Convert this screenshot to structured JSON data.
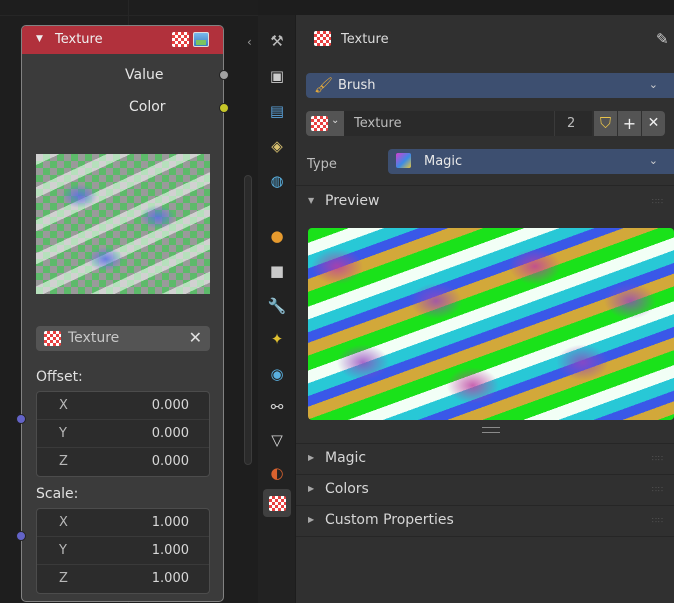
{
  "node": {
    "title": "Texture",
    "outputs": [
      {
        "label": "Value",
        "socket_color": "#a1a1a1"
      },
      {
        "label": "Color",
        "socket_color": "#c7c729"
      }
    ],
    "texture_field": {
      "label": "Texture",
      "clear": "✕"
    },
    "offset": {
      "label": "Offset:",
      "rows": [
        {
          "axis": "X",
          "value": "0.000"
        },
        {
          "axis": "Y",
          "value": "0.000"
        },
        {
          "axis": "Z",
          "value": "0.000"
        }
      ]
    },
    "scale": {
      "label": "Scale:",
      "rows": [
        {
          "axis": "X",
          "value": "1.000"
        },
        {
          "axis": "Y",
          "value": "1.000"
        },
        {
          "axis": "Z",
          "value": "1.000"
        }
      ]
    },
    "header_color": "#b1313c",
    "vector_socket_color": "#6363c7"
  },
  "tabs": [
    {
      "icon": "tool-icon",
      "glyph": "⚒"
    },
    {
      "icon": "render-icon",
      "glyph": "▣"
    },
    {
      "icon": "output-icon",
      "glyph": "▤"
    },
    {
      "icon": "view-layer-icon",
      "glyph": "◈"
    },
    {
      "icon": "scene-icon",
      "glyph": "◍"
    },
    {
      "icon": "world-icon",
      "glyph": "●"
    },
    {
      "icon": "object-icon",
      "glyph": "■"
    },
    {
      "icon": "modifier-icon",
      "glyph": "🔧"
    },
    {
      "icon": "particles-icon",
      "glyph": "✦"
    },
    {
      "icon": "physics-icon",
      "glyph": "◉"
    },
    {
      "icon": "constraints-icon",
      "glyph": "⚯"
    },
    {
      "icon": "data-icon",
      "glyph": "▽"
    },
    {
      "icon": "material-icon",
      "glyph": "◐"
    },
    {
      "icon": "texture-icon",
      "glyph": "▦"
    }
  ],
  "properties": {
    "header_title": "Texture",
    "brush_dropdown": "Brush",
    "texture_name": "Texture",
    "user_count": "2",
    "add_label": "+",
    "close_label": "✕",
    "type_label": "Type",
    "type_value": "Magic",
    "sections": [
      "Preview",
      "Magic",
      "Colors",
      "Custom Properties"
    ],
    "accent_color": "#3d4f70"
  }
}
